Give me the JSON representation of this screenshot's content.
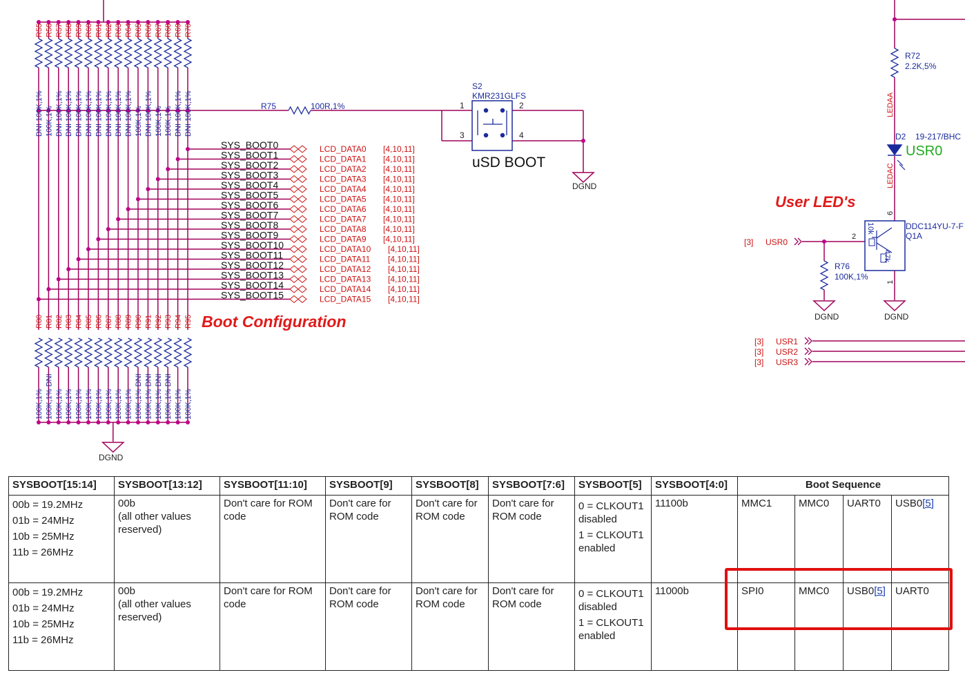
{
  "schematic": {
    "top_resistors": [
      "R55",
      "R56",
      "R57",
      "R58",
      "R59",
      "R60",
      "R61",
      "R62",
      "R63",
      "R64",
      "R65",
      "R66",
      "R67",
      "R68",
      "R69",
      "R70"
    ],
    "top_values": [
      "DNI 100K,1%",
      "100K,1%",
      "DNI 100K,1%",
      "DNI 100K,1%",
      "DNI 100K,1%",
      "DNI 100K,1%",
      "DNI 100K,1%",
      "DNI 100K,1%",
      "DNI 100K,1%",
      "DNI 100K,1%",
      "100K,1%",
      "DNI 100K,1%",
      "100K,1%",
      "100K,1%",
      "DNI 100K,1%",
      "DNI 100K,1%"
    ],
    "bottom_resistors": [
      "R80",
      "R81",
      "R82",
      "R83",
      "R84",
      "R85",
      "R86",
      "R87",
      "R88",
      "R89",
      "R90",
      "R91",
      "R92",
      "R93",
      "R94",
      "R95"
    ],
    "bottom_values": [
      "100K,1%",
      "100K,1% DNI",
      "100K,1%",
      "100K,1%",
      "100K,1%",
      "100K,1%",
      "100K,1%",
      "100K,1%",
      "100K,1%",
      "100K,1%",
      "100K,1% DNI",
      "100K,1% DNI",
      "100K,1% DNI",
      "100K,1% DNI",
      "100K,1%",
      "100K,1%"
    ],
    "sysboot_nets": [
      "SYS_BOOT0",
      "SYS_BOOT1",
      "SYS_BOOT2",
      "SYS_BOOT3",
      "SYS_BOOT4",
      "SYS_BOOT5",
      "SYS_BOOT6",
      "SYS_BOOT7",
      "SYS_BOOT8",
      "SYS_BOOT9",
      "SYS_BOOT10",
      "SYS_BOOT11",
      "SYS_BOOT12",
      "SYS_BOOT13",
      "SYS_BOOT14",
      "SYS_BOOT15"
    ],
    "lcd_nets": [
      "LCD_DATA0",
      "LCD_DATA1",
      "LCD_DATA2",
      "LCD_DATA3",
      "LCD_DATA4",
      "LCD_DATA5",
      "LCD_DATA6",
      "LCD_DATA7",
      "LCD_DATA8",
      "LCD_DATA9",
      "LCD_DATA10",
      "LCD_DATA11",
      "LCD_DATA12",
      "LCD_DATA13",
      "LCD_DATA14",
      "LCD_DATA15"
    ],
    "lcd_refs": [
      "[4,10,11]",
      "[4,10,11]",
      "[4,10,11]",
      "[4,10,11]",
      "[4,10,11]",
      "[4,10,11]",
      "[4,10,11]",
      "[4,10,11]",
      "[4,10,11]",
      "[4,10,11]",
      "[4,10,11]",
      "[4,10,11]",
      "[4,10,11]",
      "[4,10,11]",
      "[4,10,11]",
      "[4,10,11]"
    ],
    "r75_name": "R75",
    "r75_value": "100R,1%",
    "s2_name": "S2",
    "s2_part": "KMR231GLFS",
    "s2_pins": [
      "1",
      "2",
      "3",
      "4"
    ],
    "usd_boot_label": "uSD BOOT",
    "dgnd": "DGND",
    "boot_config_title": "Boot Configuration",
    "user_leds_title": "User LED's",
    "r72_name": "R72",
    "r72_value": "2.2K,5%",
    "ledaa": "LEDAA",
    "ledac": "LEDAC",
    "d2_name": "D2",
    "d2_part": "19-217/BHC",
    "usr0_green": "USR0",
    "q1_part": "DDC114YU-7-F",
    "q1_name": "Q1A",
    "q1_pins": [
      "6",
      "2",
      "1"
    ],
    "q1_r1": "10k",
    "q1_r2": "47k",
    "usr0_ref": "[3]",
    "usr0_net": "USR0",
    "r76_name": "R76",
    "r76_value": "100K,1%",
    "usr_refs": [
      "[3]",
      "[3]",
      "[3]"
    ],
    "usr_nets": [
      "USR1",
      "USR2",
      "USR3"
    ]
  },
  "table": {
    "headers": [
      "SYSBOOT[15:14]",
      "SYSBOOT[13:12]",
      "SYSBOOT[11:10]",
      "SYSBOOT[9]",
      "SYSBOOT[8]",
      "SYSBOOT[7:6]",
      "SYSBOOT[5]",
      "SYSBOOT[4:0]",
      "Boot Sequence"
    ],
    "rows": [
      {
        "freq": [
          "00b = 19.2MHz",
          "01b = 24MHz",
          "10b = 25MHz",
          "11b = 26MHz"
        ],
        "b1312": [
          "00b",
          "(all other values reserved)"
        ],
        "b1110": "Don't care for ROM code",
        "b9": "Don't care for ROM code",
        "b8": "Don't care for ROM code",
        "b76": "Don't care for ROM code",
        "b5": [
          "0 = CLKOUT1 disabled",
          "1 = CLKOUT1 enabled"
        ],
        "b40": "11100b",
        "seq": [
          "MMC1",
          "MMC0",
          "UART0",
          "USB0"
        ],
        "seq_ref": "[5]"
      },
      {
        "freq": [
          "00b = 19.2MHz",
          "01b = 24MHz",
          "10b = 25MHz",
          "11b = 26MHz"
        ],
        "b1312": [
          "00b",
          "(all other values reserved)"
        ],
        "b1110": "Don't care for ROM code",
        "b9": "Don't care for ROM code",
        "b8": "Don't care for ROM code",
        "b76": "Don't care for ROM code",
        "b5": [
          "0 = CLKOUT1 disabled",
          "1 = CLKOUT1 enabled"
        ],
        "b40": "11000b",
        "seq": [
          "SPI0",
          "MMC0",
          "USB0",
          "UART0"
        ],
        "seq_ref": "[5]"
      }
    ]
  },
  "colors": {
    "wire": "#a0005a",
    "net": "#cc1111",
    "part": "#1a2a9c",
    "title": "#e01a1a",
    "green": "#22aa22",
    "highlight": "#e01010"
  }
}
